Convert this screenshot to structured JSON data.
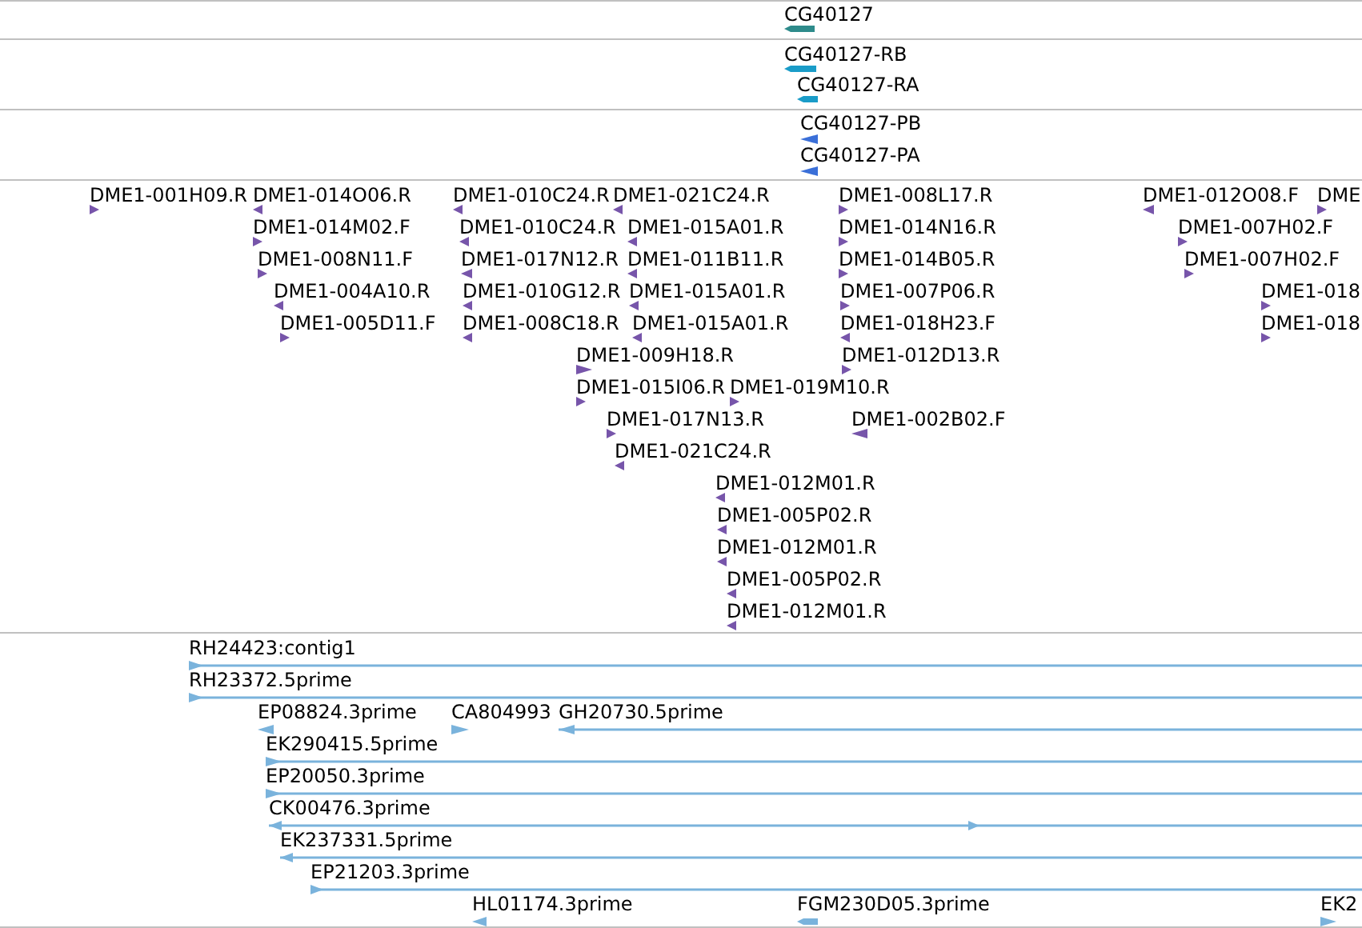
{
  "tracks": [
    {
      "color": "#2e8b8b",
      "features": [
        {
          "label": "CG40127",
          "forward": false
        }
      ]
    },
    {
      "color": "#1a9cc8",
      "features": [
        {
          "label": "CG40127-RB",
          "forward": false
        },
        {
          "label": "CG40127-RA",
          "forward": false
        }
      ]
    },
    {
      "color": "#3a6fd8",
      "features": [
        {
          "label": "CG40127-PB",
          "forward": false
        },
        {
          "label": "CG40127-PA",
          "forward": false
        }
      ]
    },
    {
      "color": "#7755aa",
      "features": [
        {
          "label": "DME1-001H09.R",
          "forward": true
        },
        {
          "label": "DME1-014O06.R",
          "forward": false
        },
        {
          "label": "DME1-010C24.R",
          "forward": false
        },
        {
          "label": "DME1-021C24.R",
          "forward": false
        },
        {
          "label": "DME1-008L17.R",
          "forward": true
        },
        {
          "label": "DME1-012O08.F",
          "forward": false
        },
        {
          "label": "DME",
          "forward": true
        },
        {
          "label": "DME1-014M02.F",
          "forward": true
        },
        {
          "label": "DME1-010C24.R",
          "forward": false
        },
        {
          "label": "DME1-015A01.R",
          "forward": false
        },
        {
          "label": "DME1-014N16.R",
          "forward": true
        },
        {
          "label": "DME1-007H02.F",
          "forward": true
        },
        {
          "label": "DME1-008N11.F",
          "forward": true
        },
        {
          "label": "DME1-017N12.R",
          "forward": false
        },
        {
          "label": "DME1-011B11.R",
          "forward": false
        },
        {
          "label": "DME1-014B05.R",
          "forward": true
        },
        {
          "label": "DME1-007H02.F",
          "forward": true
        },
        {
          "label": "DME1-004A10.R",
          "forward": false
        },
        {
          "label": "DME1-010G12.R",
          "forward": false
        },
        {
          "label": "DME1-015A01.R",
          "forward": false
        },
        {
          "label": "DME1-007P06.R",
          "forward": true
        },
        {
          "label": "DME1-018",
          "forward": true
        },
        {
          "label": "DME1-005D11.F",
          "forward": true
        },
        {
          "label": "DME1-008C18.R",
          "forward": false
        },
        {
          "label": "DME1-015A01.R",
          "forward": false
        },
        {
          "label": "DME1-018H23.F",
          "forward": false
        },
        {
          "label": "DME1-018",
          "forward": true
        },
        {
          "label": "DME1-009H18.R",
          "forward": true
        },
        {
          "label": "DME1-012D13.R",
          "forward": true
        },
        {
          "label": "DME1-015I06.R",
          "forward": true
        },
        {
          "label": "DME1-019M10.R",
          "forward": true
        },
        {
          "label": "DME1-017N13.R",
          "forward": true
        },
        {
          "label": "DME1-002B02.F",
          "forward": false
        },
        {
          "label": "DME1-021C24.R",
          "forward": false
        },
        {
          "label": "DME1-012M01.R",
          "forward": false
        },
        {
          "label": "DME1-005P02.R",
          "forward": false
        },
        {
          "label": "DME1-012M01.R",
          "forward": false
        },
        {
          "label": "DME1-005P02.R",
          "forward": false
        },
        {
          "label": "DME1-012M01.R",
          "forward": false
        }
      ]
    },
    {
      "color": "#7ab3dc",
      "features": [
        {
          "label": "RH24423:contig1",
          "forward": true
        },
        {
          "label": "RH23372.5prime",
          "forward": true
        },
        {
          "label": "EP08824.3prime",
          "forward": false
        },
        {
          "label": "CA804993",
          "forward": true
        },
        {
          "label": "GH20730.5prime",
          "forward": false
        },
        {
          "label": "EK290415.5prime",
          "forward": true
        },
        {
          "label": "EP20050.3prime",
          "forward": true
        },
        {
          "label": "CK00476.3prime",
          "forward": false
        },
        {
          "label": "EK237331.5prime",
          "forward": false
        },
        {
          "label": "EP21203.3prime",
          "forward": true
        },
        {
          "label": "HL01174.3prime",
          "forward": false
        },
        {
          "label": "FGM230D05.3prime",
          "forward": false
        },
        {
          "label": "EK2",
          "forward": true
        }
      ]
    }
  ]
}
